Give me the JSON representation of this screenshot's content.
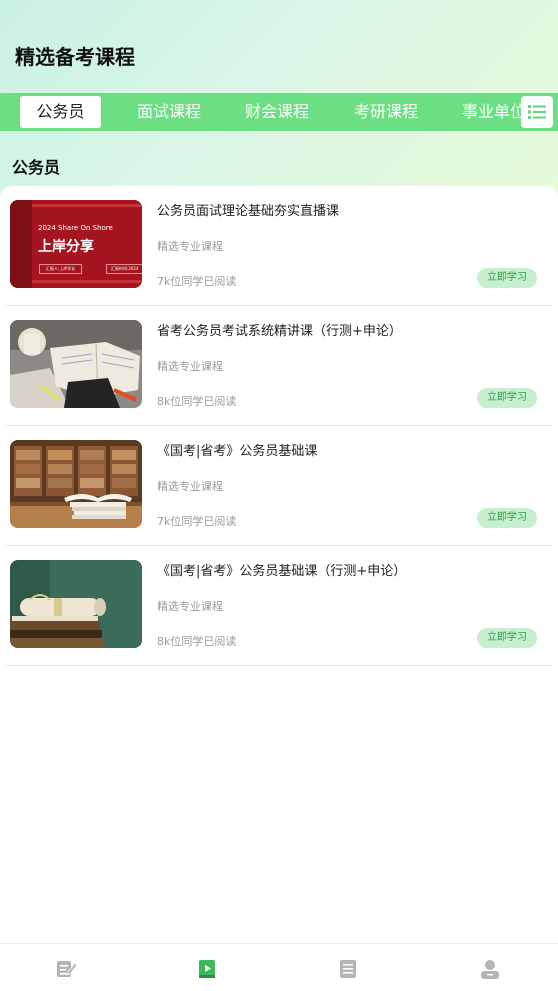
{
  "header": {
    "title": "精选备考课程"
  },
  "tabs": [
    {
      "label": "公务员",
      "active": true
    },
    {
      "label": "面试课程",
      "active": false
    },
    {
      "label": "财会课程",
      "active": false
    },
    {
      "label": "考研课程",
      "active": false
    },
    {
      "label": "事业单位",
      "active": false
    }
  ],
  "menu_icon": "list-menu-icon",
  "section": {
    "title": "公务员"
  },
  "courses": [
    {
      "title": "公务员面试理论基础夯实直播课",
      "subtitle": "精选专业课程",
      "readers": "7k位同学已阅读",
      "button": "立即学习",
      "thumb": {
        "type": "slide",
        "line1": "2024 Share On Shore",
        "line2": "上岸分享",
        "caption1": "汇报人:上岸学长",
        "caption2": "汇报时间:2024"
      }
    },
    {
      "title": "省考公务员考试系统精讲课（行测+申论）",
      "subtitle": "精选专业课程",
      "readers": "8k位同学已阅读",
      "button": "立即学习",
      "thumb": {
        "type": "desk-books"
      }
    },
    {
      "title": "《国考|省考》公务员基础课",
      "subtitle": "精选专业课程",
      "readers": "7k位同学已阅读",
      "button": "立即学习",
      "thumb": {
        "type": "library"
      }
    },
    {
      "title": "《国考|省考》公务员基础课（行测+申论）",
      "subtitle": "精选专业课程",
      "readers": "8k位同学已阅读",
      "button": "立即学习",
      "thumb": {
        "type": "chalkboard-books"
      }
    }
  ],
  "bottom_nav": [
    {
      "icon": "edit-note-icon",
      "active": false
    },
    {
      "icon": "video-book-icon",
      "active": true
    },
    {
      "icon": "article-icon",
      "active": false
    },
    {
      "icon": "user-profile-icon",
      "active": false
    }
  ],
  "colors": {
    "accent": "#6ddf83",
    "button_bg": "#c7efcf",
    "button_text": "#2f9e4a",
    "nav_active": "#3cb95a",
    "nav_inactive": "#b5b5b5"
  }
}
